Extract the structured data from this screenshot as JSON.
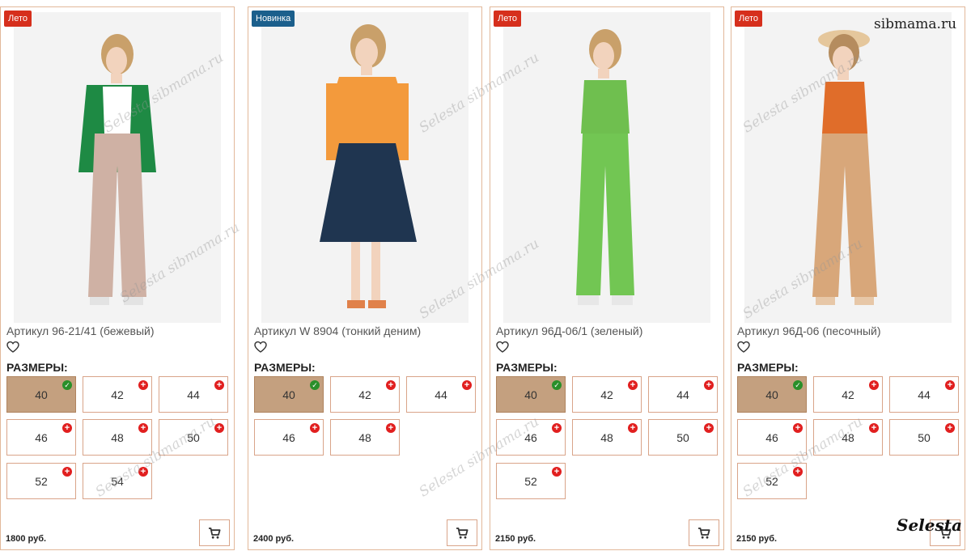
{
  "site_watermark": "sibmama.ru",
  "brand_watermark": "Selesta",
  "photo_watermark": "Selesta sibmama.ru",
  "sizes_label": "РАЗМЕРЫ:",
  "icons": {
    "favorite": "heart-outline-icon",
    "cart": "shopping-cart-icon",
    "available": "plus-circle-icon",
    "selected": "check-circle-icon"
  },
  "colors": {
    "new_badge": "#1b5f8c",
    "summer_badge": "#d62f1c",
    "selected_size": "#c4a07f",
    "border": "#e2b89a"
  },
  "products": [
    {
      "badge": "Новинка",
      "title": "Артикул W 8904 (тонкий деним)",
      "price": "2400 руб.",
      "sizes": [
        {
          "label": "40",
          "selected": true
        },
        {
          "label": "42",
          "selected": false
        },
        {
          "label": "44",
          "selected": false
        },
        {
          "label": "46",
          "selected": false
        },
        {
          "label": "48",
          "selected": false
        }
      ],
      "outfit": {
        "hair": "#c9a06a",
        "top": "#f39a3c",
        "bottom": "#1f3550",
        "shoes": "#e0814a"
      }
    },
    {
      "badge": "Лето",
      "title": "Артикул 96Д-06/1 (зеленый)",
      "price": "2150 руб.",
      "sizes": [
        {
          "label": "40",
          "selected": true
        },
        {
          "label": "42",
          "selected": false
        },
        {
          "label": "44",
          "selected": false
        },
        {
          "label": "46",
          "selected": false
        },
        {
          "label": "48",
          "selected": false
        },
        {
          "label": "50",
          "selected": false
        },
        {
          "label": "52",
          "selected": false
        }
      ],
      "outfit": {
        "hair": "#c9a06a",
        "top": "#6fbf4f",
        "bottom": "#72c653",
        "shoes": "#e7e7e7"
      }
    },
    {
      "badge": "Лето",
      "title": "Артикул 96Д-06 (песочный)",
      "price": "2150 руб.",
      "sizes": [
        {
          "label": "40",
          "selected": true
        },
        {
          "label": "42",
          "selected": false
        },
        {
          "label": "44",
          "selected": false
        },
        {
          "label": "46",
          "selected": false
        },
        {
          "label": "48",
          "selected": false
        },
        {
          "label": "50",
          "selected": false
        },
        {
          "label": "52",
          "selected": false
        }
      ],
      "outfit": {
        "hair": "#b58c5e",
        "top": "#e06d2a",
        "bottom": "#d8a77a",
        "shoes": "#e7c7a7"
      }
    },
    {
      "badge": "Лето",
      "title": "Артикул 96-21/41 (бежевый)",
      "price": "1800 руб.",
      "sizes": [
        {
          "label": "40",
          "selected": true
        },
        {
          "label": "42",
          "selected": false
        },
        {
          "label": "44",
          "selected": false
        },
        {
          "label": "46",
          "selected": false
        },
        {
          "label": "48",
          "selected": false
        },
        {
          "label": "50",
          "selected": false
        },
        {
          "label": "52",
          "selected": false
        },
        {
          "label": "54",
          "selected": false
        }
      ],
      "outfit": {
        "hair": "#c9a06a",
        "top": "#1e8a44",
        "bottom": "#cfb1a4",
        "shoes": "#e3e3e3"
      }
    }
  ]
}
